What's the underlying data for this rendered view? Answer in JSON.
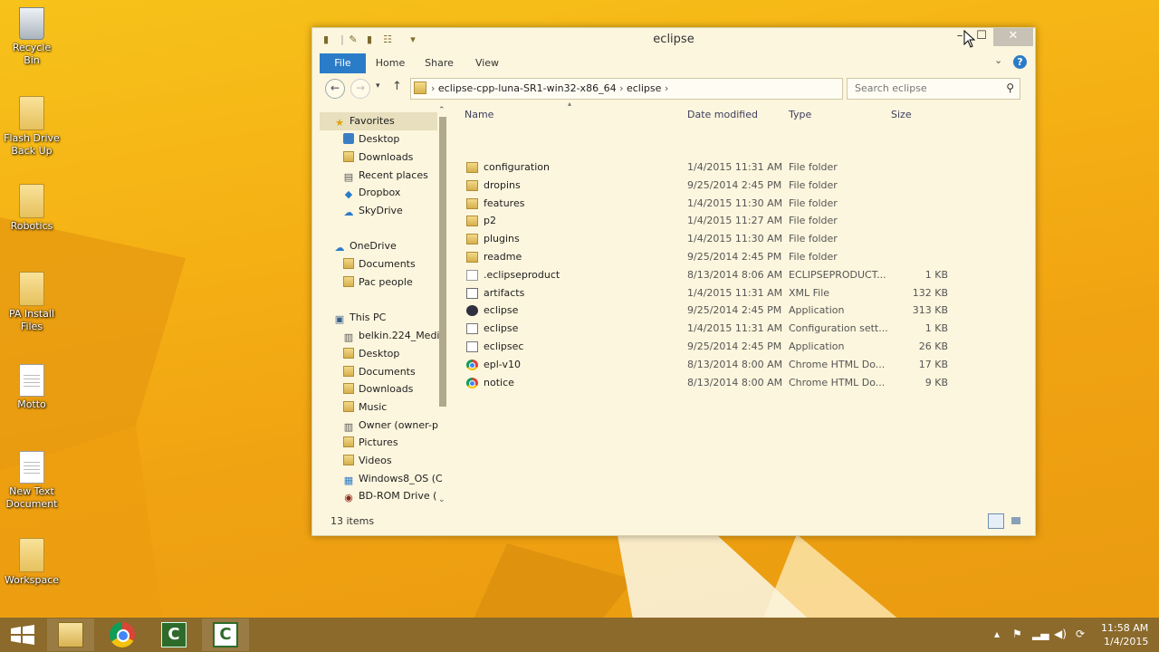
{
  "colors": {
    "desktop": "#f5b014",
    "accent": "#2b7cc8",
    "window_bg": "#fdf6de",
    "taskbar": "#8b6a2b"
  },
  "desktop": {
    "icons": [
      {
        "label": "Recycle Bin",
        "icon": "recycle-bin-icon"
      },
      {
        "label": "Flash Drive Back Up",
        "icon": "folder-icon"
      },
      {
        "label": "Robotics",
        "icon": "folder-icon"
      },
      {
        "label": "PA Install Files",
        "icon": "folder-icon"
      },
      {
        "label": "Motto",
        "icon": "text-document-icon"
      },
      {
        "label": "New Text Document",
        "icon": "text-document-icon"
      },
      {
        "label": "Workspace",
        "icon": "folder-icon"
      }
    ]
  },
  "window": {
    "title": "eclipse",
    "ribbon": {
      "tabs": [
        "File",
        "Home",
        "Share",
        "View"
      ]
    },
    "address": {
      "path": [
        "eclipse-cpp-luna-SR1-win32-x86_64",
        "eclipse"
      ],
      "search_placeholder": "Search eclipse"
    },
    "nav": {
      "favorites": {
        "label": "Favorites",
        "items": [
          "Desktop",
          "Downloads",
          "Recent places",
          "Dropbox",
          "SkyDrive"
        ]
      },
      "onedrive": {
        "label": "OneDrive",
        "items": [
          "Documents",
          "Pac people"
        ]
      },
      "thispc": {
        "label": "This PC",
        "items": [
          "belkin.224_Medi",
          "Desktop",
          "Documents",
          "Downloads",
          "Music",
          "Owner (owner-p",
          "Pictures",
          "Videos",
          "Windows8_OS (C",
          "BD-ROM Drive ("
        ]
      }
    },
    "columns": {
      "name": "Name",
      "date": "Date modified",
      "type": "Type",
      "size": "Size"
    },
    "files": [
      {
        "name": "configuration",
        "date": "1/4/2015 11:31 AM",
        "type": "File folder",
        "size": "",
        "icon": "folder"
      },
      {
        "name": "dropins",
        "date": "9/25/2014 2:45 PM",
        "type": "File folder",
        "size": "",
        "icon": "folder"
      },
      {
        "name": "features",
        "date": "1/4/2015 11:30 AM",
        "type": "File folder",
        "size": "",
        "icon": "folder"
      },
      {
        "name": "p2",
        "date": "1/4/2015 11:27 AM",
        "type": "File folder",
        "size": "",
        "icon": "folder"
      },
      {
        "name": "plugins",
        "date": "1/4/2015 11:30 AM",
        "type": "File folder",
        "size": "",
        "icon": "folder"
      },
      {
        "name": "readme",
        "date": "9/25/2014 2:45 PM",
        "type": "File folder",
        "size": "",
        "icon": "folder"
      },
      {
        "name": ".eclipseproduct",
        "date": "8/13/2014 8:06 AM",
        "type": "ECLIPSEPRODUCT...",
        "size": "1 KB",
        "icon": "file"
      },
      {
        "name": "artifacts",
        "date": "1/4/2015 11:31 AM",
        "type": "XML File",
        "size": "132 KB",
        "icon": "xml"
      },
      {
        "name": "eclipse",
        "date": "9/25/2014 2:45 PM",
        "type": "Application",
        "size": "313 KB",
        "icon": "app"
      },
      {
        "name": "eclipse",
        "date": "1/4/2015 11:31 AM",
        "type": "Configuration sett...",
        "size": "1 KB",
        "icon": "cfg"
      },
      {
        "name": "eclipsec",
        "date": "9/25/2014 2:45 PM",
        "type": "Application",
        "size": "26 KB",
        "icon": "cfg"
      },
      {
        "name": "epl-v10",
        "date": "8/13/2014 8:00 AM",
        "type": "Chrome HTML Do...",
        "size": "17 KB",
        "icon": "chrome"
      },
      {
        "name": "notice",
        "date": "8/13/2014 8:00 AM",
        "type": "Chrome HTML Do...",
        "size": "9 KB",
        "icon": "chrome"
      }
    ],
    "status": "13 items"
  },
  "taskbar": {
    "apps": [
      "file-explorer-icon",
      "chrome-icon",
      "camtasia-icon",
      "camtasia-recorder-icon"
    ],
    "clock": {
      "time": "11:58 AM",
      "date": "1/4/2015"
    }
  }
}
